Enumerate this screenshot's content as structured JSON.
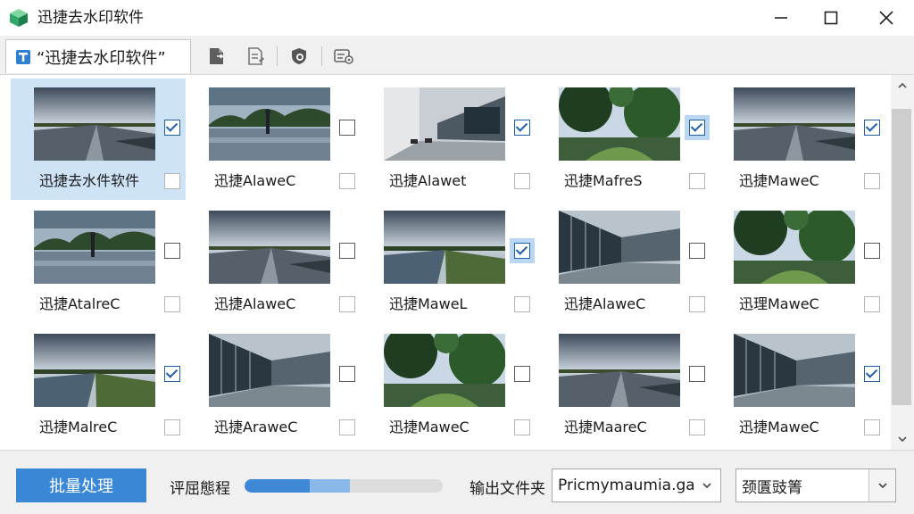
{
  "window": {
    "title": "迅捷去水印软件",
    "icon": "green-cube-icon",
    "controls": [
      "minimize-icon",
      "maximize-icon",
      "close-icon"
    ]
  },
  "toolbar": {
    "tab_label": "“迅捷去水印软件”",
    "buttons": [
      "file-export-icon",
      "page-edit-icon",
      "shield-icon",
      "settings-icon"
    ]
  },
  "grid": {
    "items": [
      {
        "label": "迅捷去水件软件",
        "thumb": "road-horizon",
        "checked": true,
        "selected": true,
        "highlight": false
      },
      {
        "label": "迅捷AlaweC",
        "thumb": "wet-park-figure",
        "checked": false,
        "selected": false,
        "highlight": false
      },
      {
        "label": "迅捷Alawet",
        "thumb": "modern-building-patio",
        "checked": true,
        "selected": false,
        "highlight": false
      },
      {
        "label": "迅捷MafreS",
        "thumb": "forest-trees",
        "checked": true,
        "selected": false,
        "highlight": true
      },
      {
        "label": "迅捷MaweC",
        "thumb": "road-horizon",
        "checked": true,
        "selected": false,
        "highlight": false
      },
      {
        "label": "迅捷AtalreC",
        "thumb": "wet-park-figure",
        "checked": false,
        "selected": false,
        "highlight": false
      },
      {
        "label": "迅捷AlaweC",
        "thumb": "road-horizon",
        "checked": false,
        "selected": false,
        "highlight": false
      },
      {
        "label": "迅捷MaweL",
        "thumb": "water-channel",
        "checked": true,
        "selected": false,
        "highlight": true
      },
      {
        "label": "迅捷AlaweC",
        "thumb": "glass-building-road",
        "checked": false,
        "selected": false,
        "highlight": false
      },
      {
        "label": "迅理MaweC",
        "thumb": "forest-trees",
        "checked": false,
        "selected": false,
        "highlight": false
      },
      {
        "label": "迅捷MalreC",
        "thumb": "water-channel",
        "checked": true,
        "selected": false,
        "highlight": false
      },
      {
        "label": "迅捷AraweC",
        "thumb": "glass-building-road",
        "checked": false,
        "selected": false,
        "highlight": false
      },
      {
        "label": "迅捷MaweC",
        "thumb": "forest-trees",
        "checked": false,
        "selected": false,
        "highlight": false
      },
      {
        "label": "迅捷MaareC",
        "thumb": "road-horizon",
        "checked": false,
        "selected": false,
        "highlight": false
      },
      {
        "label": "迅捷MaweC",
        "thumb": "glass-building-road",
        "checked": true,
        "selected": false,
        "highlight": false
      }
    ]
  },
  "bottom": {
    "batch_button": "批量处理",
    "progress_label": "评屈態程",
    "progress": 0.53,
    "output_label": "输出文件夹",
    "output_value": "Pricmymaumia.gaa",
    "format_value": "颈匱豉箐"
  },
  "colors": {
    "accent": "#3a87d6",
    "selection": "#cfe3f7",
    "checkbox_highlight": "#b9d7f3",
    "toolbar_bg": "#f0f0f0"
  }
}
